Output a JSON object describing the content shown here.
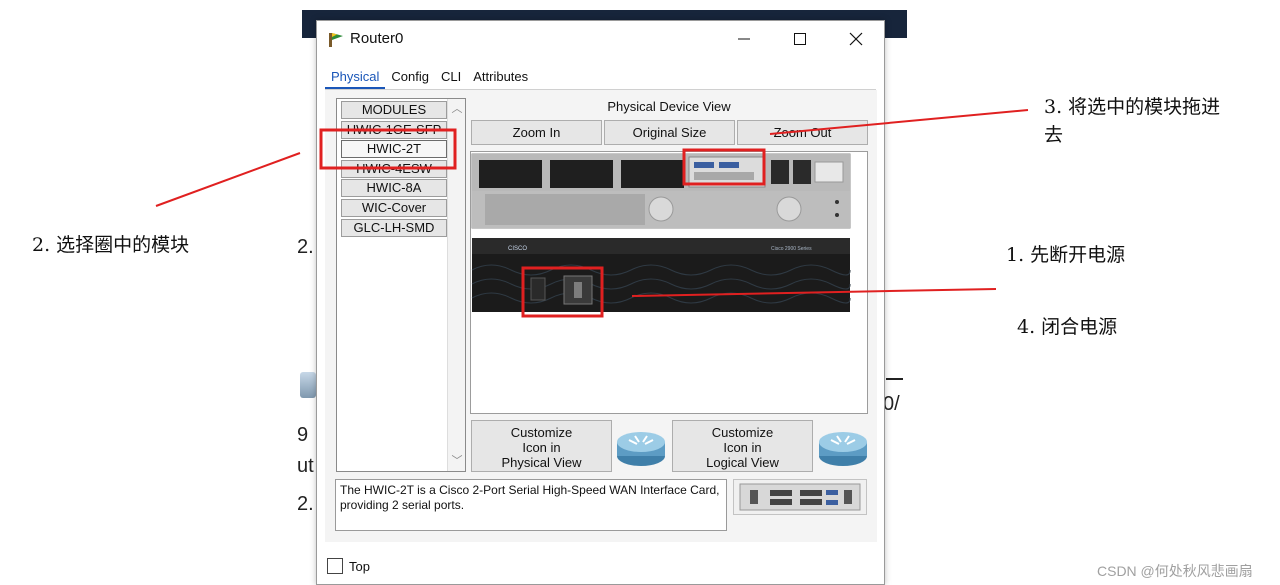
{
  "window": {
    "title": "Router0",
    "controls": {
      "minimize": "minimize",
      "maximize": "maximize",
      "close": "close"
    }
  },
  "tabs": [
    {
      "label": "Physical",
      "active": true
    },
    {
      "label": "Config",
      "active": false
    },
    {
      "label": "CLI",
      "active": false
    },
    {
      "label": "Attributes",
      "active": false
    }
  ],
  "modules": {
    "header": "MODULES",
    "items": [
      {
        "label": "HWIC-1GE-SFP",
        "state": "struck"
      },
      {
        "label": "HWIC-2T",
        "state": "selected"
      },
      {
        "label": "HWIC-4ESW",
        "state": "struck"
      },
      {
        "label": "HWIC-8A",
        "state": "normal"
      },
      {
        "label": "WIC-Cover",
        "state": "normal"
      },
      {
        "label": "GLC-LH-SMD",
        "state": "normal"
      }
    ]
  },
  "device_view": {
    "label": "Physical Device View",
    "zoom_in": "Zoom In",
    "original_size": "Original Size",
    "zoom_out": "Zoom Out",
    "chassis_brand": "CISCO",
    "chassis_model": "Cisco 2900 Series"
  },
  "customize": {
    "physical": [
      "Customize",
      "Icon in",
      "Physical View"
    ],
    "logical": [
      "Customize",
      "Icon in",
      "Logical View"
    ]
  },
  "description": "The HWIC-2T is a Cisco 2-Port Serial High-Speed WAN Interface Card, providing 2 serial ports.",
  "top_checkbox": {
    "label": "Top",
    "checked": false
  },
  "annotations": {
    "step1": "1. 先断开电源",
    "step2": "2.  选择圈中的模块",
    "step3_line1": "3. 将选中的模块拖进",
    "step3_line2": "去",
    "step4": "4. 闭合电源",
    "color": "#e02020"
  },
  "background_fragments": {
    "a": "2.",
    "b": "9",
    "c": "ut",
    "d": "2.",
    "e": "0/"
  },
  "watermark": "CSDN @何处秋风悲画扇",
  "colors": {
    "accent_tab": "#1a56b8",
    "highlight_red": "#e02020",
    "chassis_dark": "#1b1b1b"
  }
}
